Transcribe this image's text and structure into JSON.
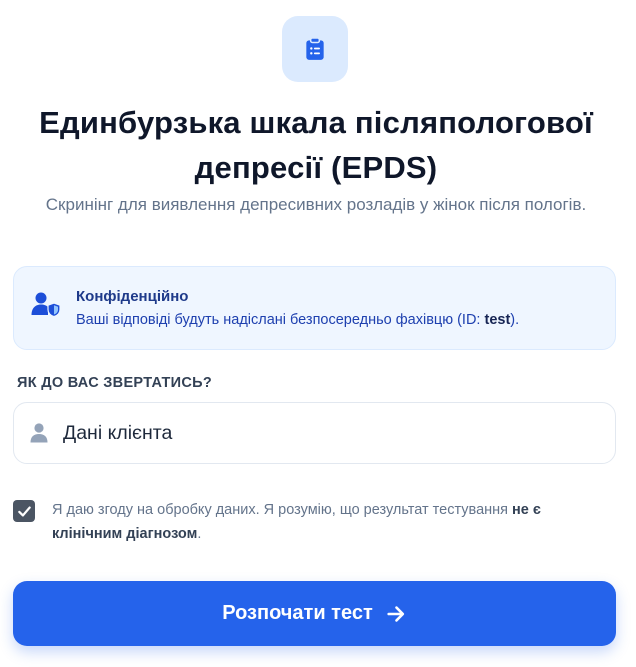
{
  "header": {
    "logo_icon": "clipboard-list-icon",
    "title": "Единбурзька шкала післяпологової депресії (EPDS)",
    "subtitle": "Скринінг для виявлення депресивних розладів у жінок після пологів."
  },
  "notice": {
    "icon": "user-shield-icon",
    "title": "Конфіденційно",
    "text_before": "Ваші відповіді будуть надіслані безпосередньо фахівцю (ID: ",
    "id": "test",
    "text_after": ")."
  },
  "name_field": {
    "label": "ЯК ДО ВАС ЗВЕРТАТИСЬ?",
    "icon": "user-icon",
    "value": "Дані клієнта",
    "placeholder": ""
  },
  "consent": {
    "checked": true,
    "text": "Я даю згоду на обробку даних. Я розумію, що результат тестування ",
    "bold": "не є клінічним діагнозом",
    "end": "."
  },
  "start_button": {
    "label": "Розпочати тест",
    "icon": "arrow-right-icon"
  },
  "colors": {
    "primary": "#2563eb",
    "notice_bg": "#eff6ff",
    "logo_bg": "#dbeafe"
  }
}
